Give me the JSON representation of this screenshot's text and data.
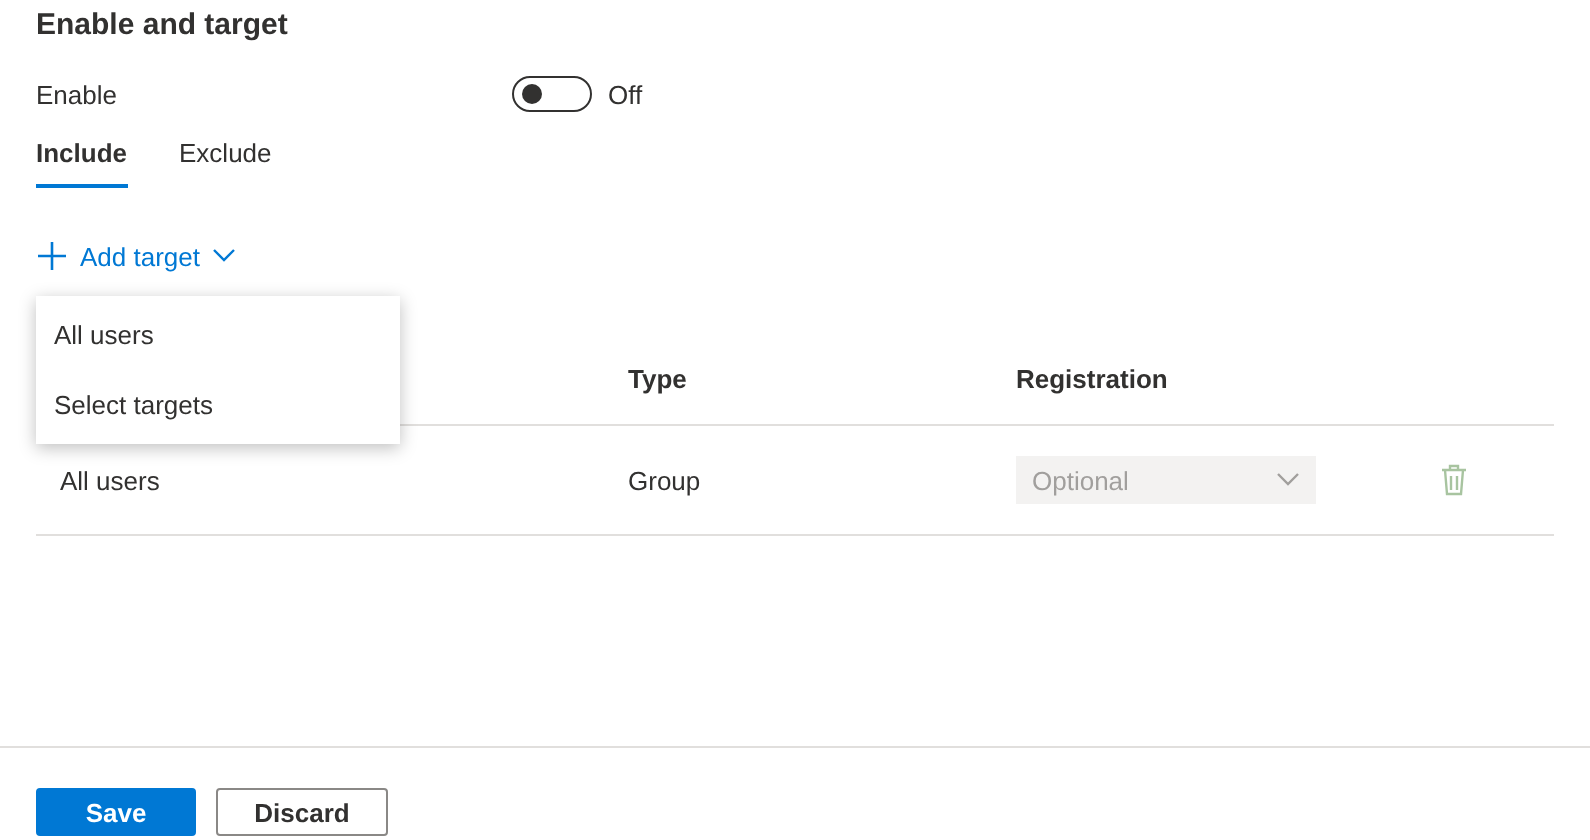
{
  "section_title": "Enable and target",
  "enable": {
    "label": "Enable",
    "on": false,
    "state_text": "Off"
  },
  "tabs": [
    {
      "label": "Include",
      "selected": true
    },
    {
      "label": "Exclude",
      "selected": false
    }
  ],
  "add_target": {
    "label": "Add target"
  },
  "menu": {
    "items": [
      {
        "label": "All users"
      },
      {
        "label": "Select targets"
      }
    ]
  },
  "table": {
    "columns": [
      "Type",
      "Registration"
    ],
    "rows": [
      {
        "name": "All users",
        "type": "Group",
        "registration": {
          "value": "Optional",
          "disabled": true
        },
        "delete_disabled": true
      }
    ]
  },
  "buttons": [
    {
      "label": "Save",
      "kind": "primary"
    },
    {
      "label": "Discard",
      "kind": "secondary"
    }
  ]
}
